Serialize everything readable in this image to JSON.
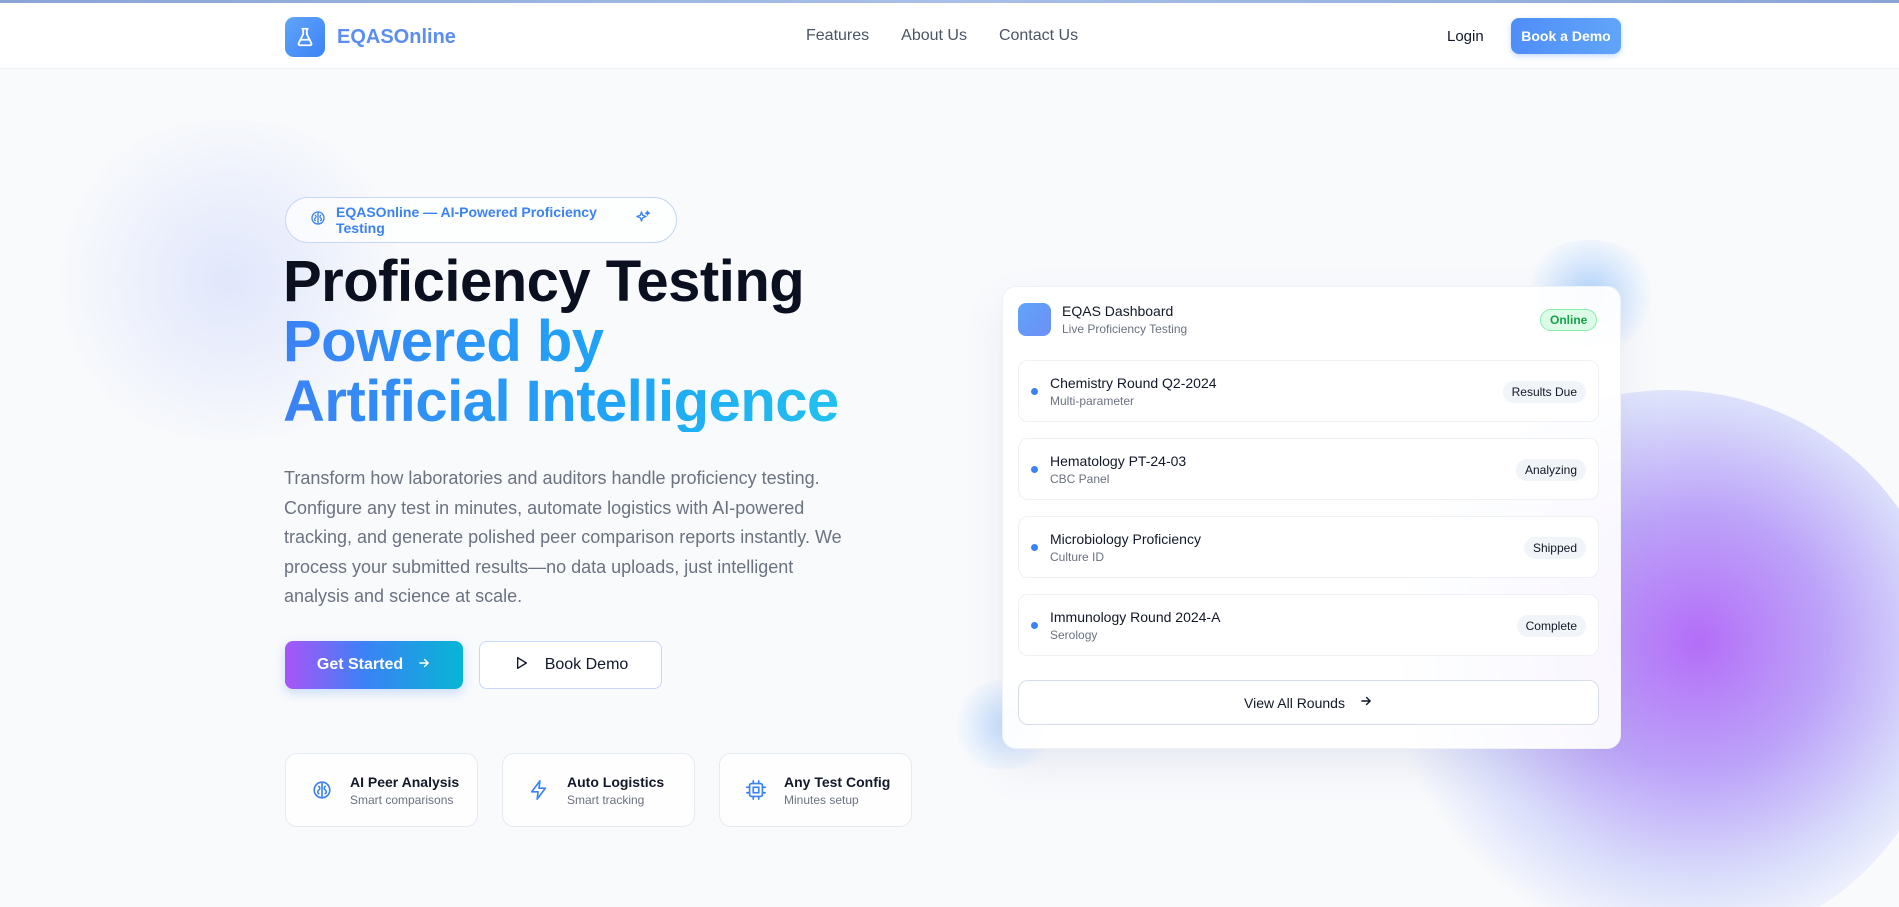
{
  "nav": {
    "brand": "EQASOnline",
    "links": [
      "Features",
      "About Us",
      "Contact Us"
    ],
    "login": "Login",
    "cta": "Book a Demo"
  },
  "hero": {
    "badge": "EQASOnline — AI-Powered Proficiency Testing",
    "title_line1": "Proficiency Testing",
    "title_line2": "Powered by",
    "title_line3": "Artificial Intelligence",
    "description": "Transform how laboratories and auditors handle proficiency testing. Configure any test in minutes, automate logistics with AI-powered tracking, and generate polished peer comparison reports instantly. We process your submitted results—no data uploads, just intelligent analysis and science at scale.",
    "primary_button": "Get Started",
    "secondary_button": "Book Demo"
  },
  "features": [
    {
      "title": "AI Peer Analysis",
      "subtitle": "Smart comparisons",
      "icon": "brain-icon"
    },
    {
      "title": "Auto Logistics",
      "subtitle": "Smart tracking",
      "icon": "lightning-icon"
    },
    {
      "title": "Any Test Config",
      "subtitle": "Minutes setup",
      "icon": "cpu-icon"
    }
  ],
  "dashboard": {
    "title": "EQAS Dashboard",
    "subtitle": "Live Proficiency Testing",
    "status": "Online",
    "rounds": [
      {
        "name": "Chemistry Round Q2-2024",
        "detail": "Multi-parameter",
        "status": "Results Due"
      },
      {
        "name": "Hematology PT-24-03",
        "detail": "CBC Panel",
        "status": "Analyzing"
      },
      {
        "name": "Microbiology Proficiency",
        "detail": "Culture ID",
        "status": "Shipped"
      },
      {
        "name": "Immunology Round 2024-A",
        "detail": "Serology",
        "status": "Complete"
      }
    ],
    "view_all": "View All Rounds"
  },
  "colors": {
    "accent": "#3b82f6",
    "brand_text": "#5b8ef0",
    "gradient_start": "#a855f7",
    "gradient_end": "#06b6d4",
    "online_green": "#16a34a"
  }
}
